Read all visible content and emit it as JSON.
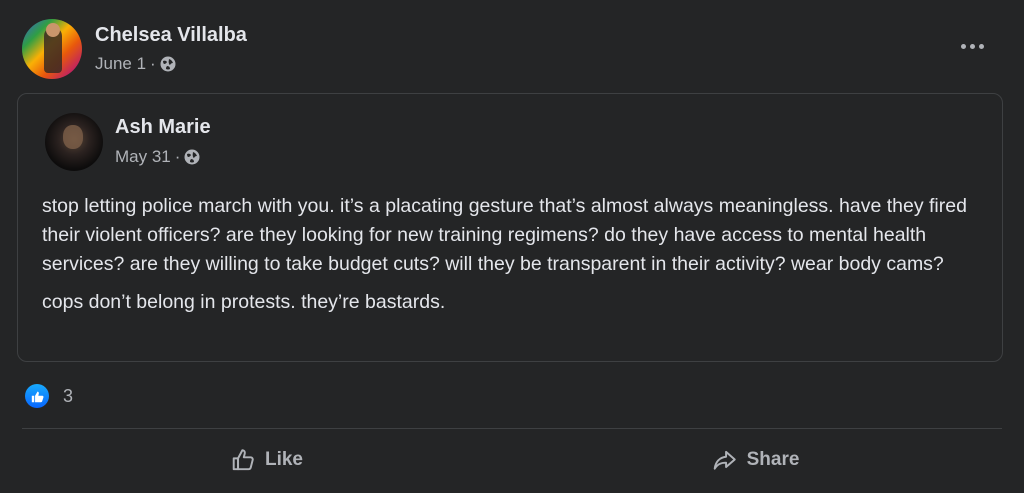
{
  "post": {
    "author": "Chelsea Villalba",
    "date": "June 1",
    "separator": "·",
    "privacy_icon": "globe-icon",
    "more_icon": "more-options-icon"
  },
  "shared_post": {
    "author": "Ash Marie",
    "date": "May 31",
    "separator": "·",
    "privacy_icon": "globe-icon",
    "paragraphs": [
      "stop letting police march with you. it’s a placating gesture that’s almost always meaningless. have they fired their violent officers? are they looking for new training regimens? do they have access to mental health services? are they willing to take budget cuts? will they be transparent in their activity? wear body cams?",
      "cops don’t belong in protests. they’re bastards."
    ]
  },
  "reactions": {
    "icon": "like-reaction-icon",
    "count": "3"
  },
  "actions": {
    "like_label": "Like",
    "share_label": "Share"
  },
  "colors": {
    "background": "#242526",
    "primary_text": "#e4e6eb",
    "secondary_text": "#b0b3b8",
    "like_blue": "#0866ff"
  }
}
